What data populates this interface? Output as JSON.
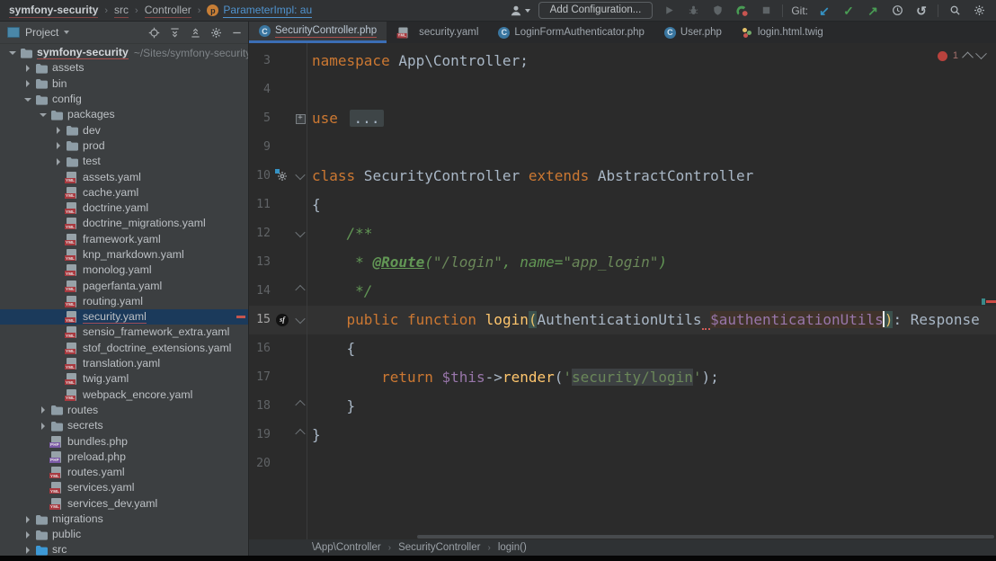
{
  "title_bar": {
    "breadcrumbs": [
      "symfony-security",
      "src",
      "Controller"
    ],
    "active_item": {
      "icon_letter": "p",
      "label": "ParameterImpl: au"
    },
    "actions": [
      {
        "name": "user-menu",
        "kind": "icon",
        "icon": "person"
      },
      {
        "name": "add-configuration-button",
        "kind": "button",
        "label": "Add Configuration..."
      },
      {
        "name": "run-button",
        "kind": "icon",
        "icon": "play",
        "disabled": true
      },
      {
        "name": "debug-button",
        "kind": "icon",
        "icon": "bug",
        "disabled": true
      },
      {
        "name": "coverage-button",
        "kind": "icon",
        "icon": "coverage",
        "disabled": true
      },
      {
        "name": "debug-listener-toggle",
        "kind": "icon",
        "icon": "phone-listener"
      },
      {
        "name": "stop-button",
        "kind": "icon",
        "icon": "stop",
        "disabled": true
      },
      {
        "name": "group-separator-1",
        "kind": "sep"
      },
      {
        "name": "git-label",
        "kind": "label",
        "label": "Git:"
      },
      {
        "name": "git-update-button",
        "kind": "glyph",
        "glyph": "↙",
        "color": "#3592C4"
      },
      {
        "name": "git-commit-button",
        "kind": "glyph",
        "glyph": "✓",
        "color": "#499C54"
      },
      {
        "name": "git-push-button",
        "kind": "glyph",
        "glyph": "↗",
        "color": "#499C54"
      },
      {
        "name": "local-history-button",
        "kind": "icon",
        "icon": "clock"
      },
      {
        "name": "rollback-button",
        "kind": "glyph",
        "glyph": "↺",
        "color": "#AFB6BB"
      },
      {
        "name": "group-separator-2",
        "kind": "sep"
      },
      {
        "name": "search-everywhere-button",
        "kind": "icon",
        "icon": "search"
      },
      {
        "name": "settings-button",
        "kind": "icon",
        "icon": "gear"
      }
    ]
  },
  "project_panel": {
    "title": "Project",
    "header_actions": [
      {
        "name": "locate-file-button",
        "icon": "target"
      },
      {
        "name": "expand-all-button",
        "icon": "expand"
      },
      {
        "name": "collapse-all-button",
        "icon": "collapse"
      },
      {
        "name": "panel-settings-button",
        "icon": "gear"
      },
      {
        "name": "hide-panel-button",
        "icon": "minus"
      }
    ],
    "tree": [
      {
        "label": "symfony-security",
        "type": "folder",
        "level": 0,
        "chev": "open",
        "bold": true,
        "err": true,
        "suffix": "~/Sites/symfony-security"
      },
      {
        "label": "assets",
        "type": "folder",
        "level": 1,
        "chev": "closed"
      },
      {
        "label": "bin",
        "type": "folder",
        "level": 1,
        "chev": "closed"
      },
      {
        "label": "config",
        "type": "folder",
        "level": 1,
        "chev": "open"
      },
      {
        "label": "packages",
        "type": "folder",
        "level": 2,
        "chev": "open"
      },
      {
        "label": "dev",
        "type": "folder",
        "level": 3,
        "chev": "closed"
      },
      {
        "label": "prod",
        "type": "folder",
        "level": 3,
        "chev": "closed"
      },
      {
        "label": "test",
        "type": "folder",
        "level": 3,
        "chev": "closed"
      },
      {
        "label": "assets.yaml",
        "type": "yaml",
        "level": 3
      },
      {
        "label": "cache.yaml",
        "type": "yaml",
        "level": 3
      },
      {
        "label": "doctrine.yaml",
        "type": "yaml",
        "level": 3
      },
      {
        "label": "doctrine_migrations.yaml",
        "type": "yaml",
        "level": 3
      },
      {
        "label": "framework.yaml",
        "type": "yaml",
        "level": 3
      },
      {
        "label": "knp_markdown.yaml",
        "type": "yaml",
        "level": 3
      },
      {
        "label": "monolog.yaml",
        "type": "yaml",
        "level": 3
      },
      {
        "label": "pagerfanta.yaml",
        "type": "yaml",
        "level": 3
      },
      {
        "label": "routing.yaml",
        "type": "yaml",
        "level": 3
      },
      {
        "label": "security.yaml",
        "type": "yaml",
        "level": 3,
        "selected": true,
        "err": true
      },
      {
        "label": "sensio_framework_extra.yaml",
        "type": "yaml",
        "level": 3
      },
      {
        "label": "stof_doctrine_extensions.yaml",
        "type": "yaml",
        "level": 3
      },
      {
        "label": "translation.yaml",
        "type": "yaml",
        "level": 3
      },
      {
        "label": "twig.yaml",
        "type": "yaml",
        "level": 3
      },
      {
        "label": "webpack_encore.yaml",
        "type": "yaml",
        "level": 3
      },
      {
        "label": "routes",
        "type": "folder",
        "level": 2,
        "chev": "closed"
      },
      {
        "label": "secrets",
        "type": "folder",
        "level": 2,
        "chev": "closed"
      },
      {
        "label": "bundles.php",
        "type": "php",
        "level": 2
      },
      {
        "label": "preload.php",
        "type": "php",
        "level": 2
      },
      {
        "label": "routes.yaml",
        "type": "yaml",
        "level": 2
      },
      {
        "label": "services.yaml",
        "type": "yaml",
        "level": 2
      },
      {
        "label": "services_dev.yaml",
        "type": "yaml",
        "level": 2
      },
      {
        "label": "migrations",
        "type": "folder",
        "level": 1,
        "chev": "closed"
      },
      {
        "label": "public",
        "type": "folder",
        "level": 1,
        "chev": "closed"
      },
      {
        "label": "src",
        "type": "folder-src",
        "level": 1,
        "chev": "closed",
        "err": true
      }
    ]
  },
  "editor": {
    "tabs": [
      {
        "label": "SecurityController.php",
        "icon": "php-class",
        "active": true,
        "error": true
      },
      {
        "label": "security.yaml",
        "icon": "yaml"
      },
      {
        "label": "LoginFormAuthenticator.php",
        "icon": "php-class"
      },
      {
        "label": "User.php",
        "icon": "php-class"
      },
      {
        "label": "login.html.twig",
        "icon": "twig"
      }
    ],
    "inspection": {
      "error_count": "1"
    },
    "lines": [
      {
        "n": "3",
        "seg": [
          [
            "k",
            "namespace"
          ],
          [
            "t",
            " App\\Controller;"
          ]
        ]
      },
      {
        "n": "4",
        "seg": []
      },
      {
        "n": "5",
        "fold": "plus",
        "seg": [
          [
            "k",
            "use"
          ],
          [
            "t",
            " "
          ],
          [
            "fold",
            "..."
          ]
        ]
      },
      {
        "n": "9",
        "seg": []
      },
      {
        "n": "10",
        "gicon": "service-gear",
        "fold": "down",
        "seg": [
          [
            "k",
            "class"
          ],
          [
            "t",
            " SecurityController "
          ],
          [
            "k",
            "extends"
          ],
          [
            "t",
            " AbstractController"
          ]
        ]
      },
      {
        "n": "11",
        "seg": [
          [
            "t",
            "{"
          ]
        ]
      },
      {
        "n": "12",
        "fold": "down",
        "seg": [
          [
            "c",
            "    /**"
          ]
        ]
      },
      {
        "n": "13",
        "seg": [
          [
            "c",
            "     * "
          ],
          [
            "ca",
            "@Route"
          ],
          [
            "c",
            "("
          ],
          [
            "cs",
            "\"/login\""
          ],
          [
            "c",
            ", name="
          ],
          [
            "cs",
            "\"app_login\""
          ],
          [
            "c",
            ")"
          ]
        ]
      },
      {
        "n": "14",
        "fold": "up",
        "seg": [
          [
            "c",
            "     */"
          ]
        ]
      },
      {
        "n": "15",
        "cur": true,
        "gicon": "symfony",
        "fold": "down",
        "seg": [
          [
            "t",
            "    "
          ],
          [
            "k",
            "public"
          ],
          [
            "t",
            " "
          ],
          [
            "k",
            "function"
          ],
          [
            "t",
            " "
          ],
          [
            "f",
            "login"
          ],
          [
            "pb",
            "("
          ],
          [
            "t",
            "AuthenticationUtils"
          ],
          [
            "sqg",
            " "
          ],
          [
            "vh",
            "$authenticationUtils"
          ],
          [
            "caret",
            ""
          ],
          [
            "pb",
            ")"
          ],
          [
            "t",
            ": Response"
          ]
        ]
      },
      {
        "n": "16",
        "seg": [
          [
            "t",
            "    {"
          ]
        ]
      },
      {
        "n": "17",
        "seg": [
          [
            "t",
            "        "
          ],
          [
            "k",
            "return"
          ],
          [
            "t",
            " "
          ],
          [
            "v",
            "$this"
          ],
          [
            "t",
            "->"
          ],
          [
            "f",
            "render"
          ],
          [
            "t",
            "("
          ],
          [
            "s",
            "'"
          ],
          [
            "inj",
            "security/login"
          ],
          [
            "s",
            "'"
          ],
          [
            "t",
            ");"
          ]
        ]
      },
      {
        "n": "18",
        "fold": "up",
        "seg": [
          [
            "t",
            "    }"
          ]
        ]
      },
      {
        "n": "19",
        "fold": "up",
        "seg": [
          [
            "t",
            "}"
          ]
        ]
      },
      {
        "n": "20",
        "seg": []
      }
    ],
    "breadcrumbs": [
      "\\App\\Controller",
      "SecurityController",
      "login()"
    ]
  }
}
